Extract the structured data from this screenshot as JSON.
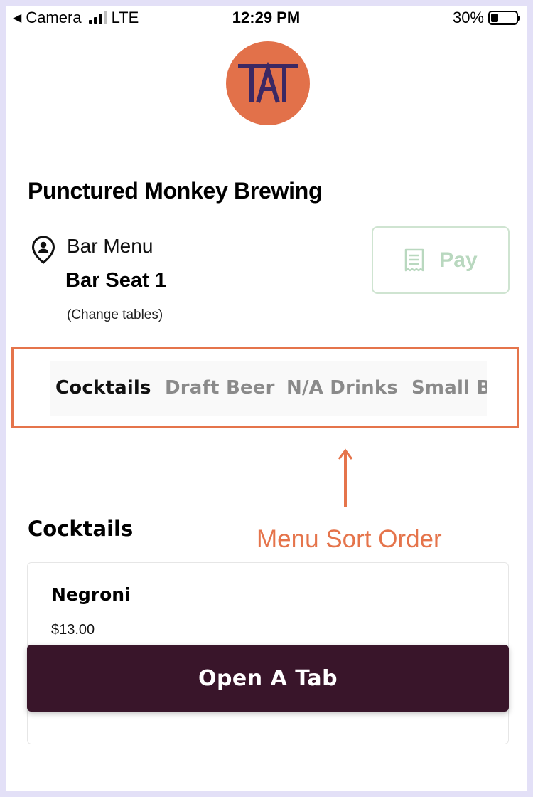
{
  "status_bar": {
    "back_label": "Camera",
    "network": "LTE",
    "time": "12:29 PM",
    "battery": "30%",
    "battery_level": 0.3
  },
  "logo": {
    "text": "TAT",
    "color": "#e2714a",
    "text_color": "#3b2863"
  },
  "venue": {
    "name": "Punctured Monkey Brewing"
  },
  "location": {
    "icon": "location-pin-person-icon",
    "menu_name": "Bar Menu",
    "seat": "Bar Seat 1",
    "change_tables": "(Change tables)"
  },
  "pay_button": {
    "label": "Pay",
    "icon": "receipt-icon",
    "color": "#b9d8bf"
  },
  "tabs": [
    {
      "label": "Cocktails",
      "active": true
    },
    {
      "label": "Draft Beer",
      "active": false
    },
    {
      "label": "N/A Drinks",
      "active": false
    },
    {
      "label": "Small Bi",
      "active": false
    }
  ],
  "annotation": {
    "text": "Menu Sort Order",
    "color": "#e5744b"
  },
  "section": {
    "heading": "Cocktails"
  },
  "menu_item": {
    "name": "Negroni",
    "price": "$13.00"
  },
  "open_tab_button": {
    "label": "Open A Tab",
    "color": "#39152a"
  }
}
